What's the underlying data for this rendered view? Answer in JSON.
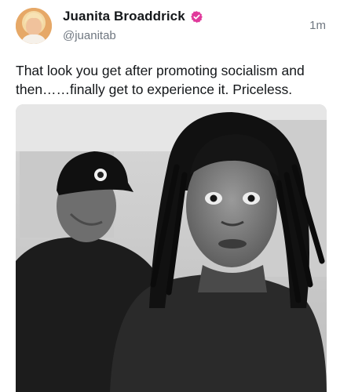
{
  "post": {
    "author": {
      "display_name": "Juanita Broaddrick",
      "handle": "@juanitab",
      "verified": true,
      "verified_color": "#e0399b"
    },
    "timestamp": "1m",
    "text": "That look you get after promoting socialism and then……finally get to experience it. Priceless.",
    "media": {
      "type": "photo",
      "tone": "black-and-white"
    }
  },
  "colors": {
    "text_primary": "#14171a",
    "text_secondary": "#6f7780",
    "background": "#ffffff"
  }
}
